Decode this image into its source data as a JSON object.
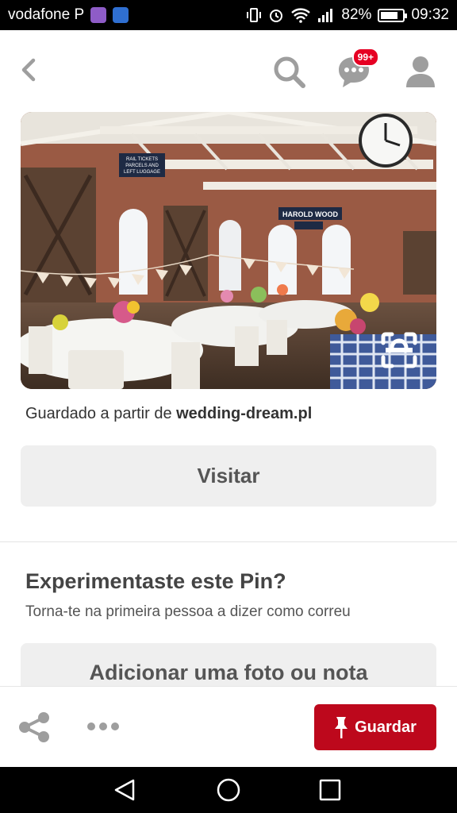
{
  "status_bar": {
    "carrier": "vodafone P",
    "battery": "82%",
    "battery_level": 0.82,
    "time": "09:32"
  },
  "topbar": {
    "notification_count": "99+"
  },
  "pin": {
    "source_prefix": "Guardado a partir de",
    "source_domain": "wedding-dream.pl",
    "visit_label": "Visitar",
    "image_signs": {
      "tickets": [
        "RAIL TICKETS",
        "PARCELS AND",
        "LEFT LUGGAGE"
      ],
      "station": "HAROLD WOOD"
    }
  },
  "tried": {
    "title": "Experimentaste este Pin?",
    "subtitle": "Torna-te na primeira pessoa a dizer como correu",
    "add_label": "Adicionar uma foto ou nota"
  },
  "action_bar": {
    "save_label": "Guardar"
  },
  "colors": {
    "accent": "#bd081c",
    "badge": "#e60023",
    "button_bg": "#efefef",
    "icon_gray": "#9e9e9e"
  }
}
